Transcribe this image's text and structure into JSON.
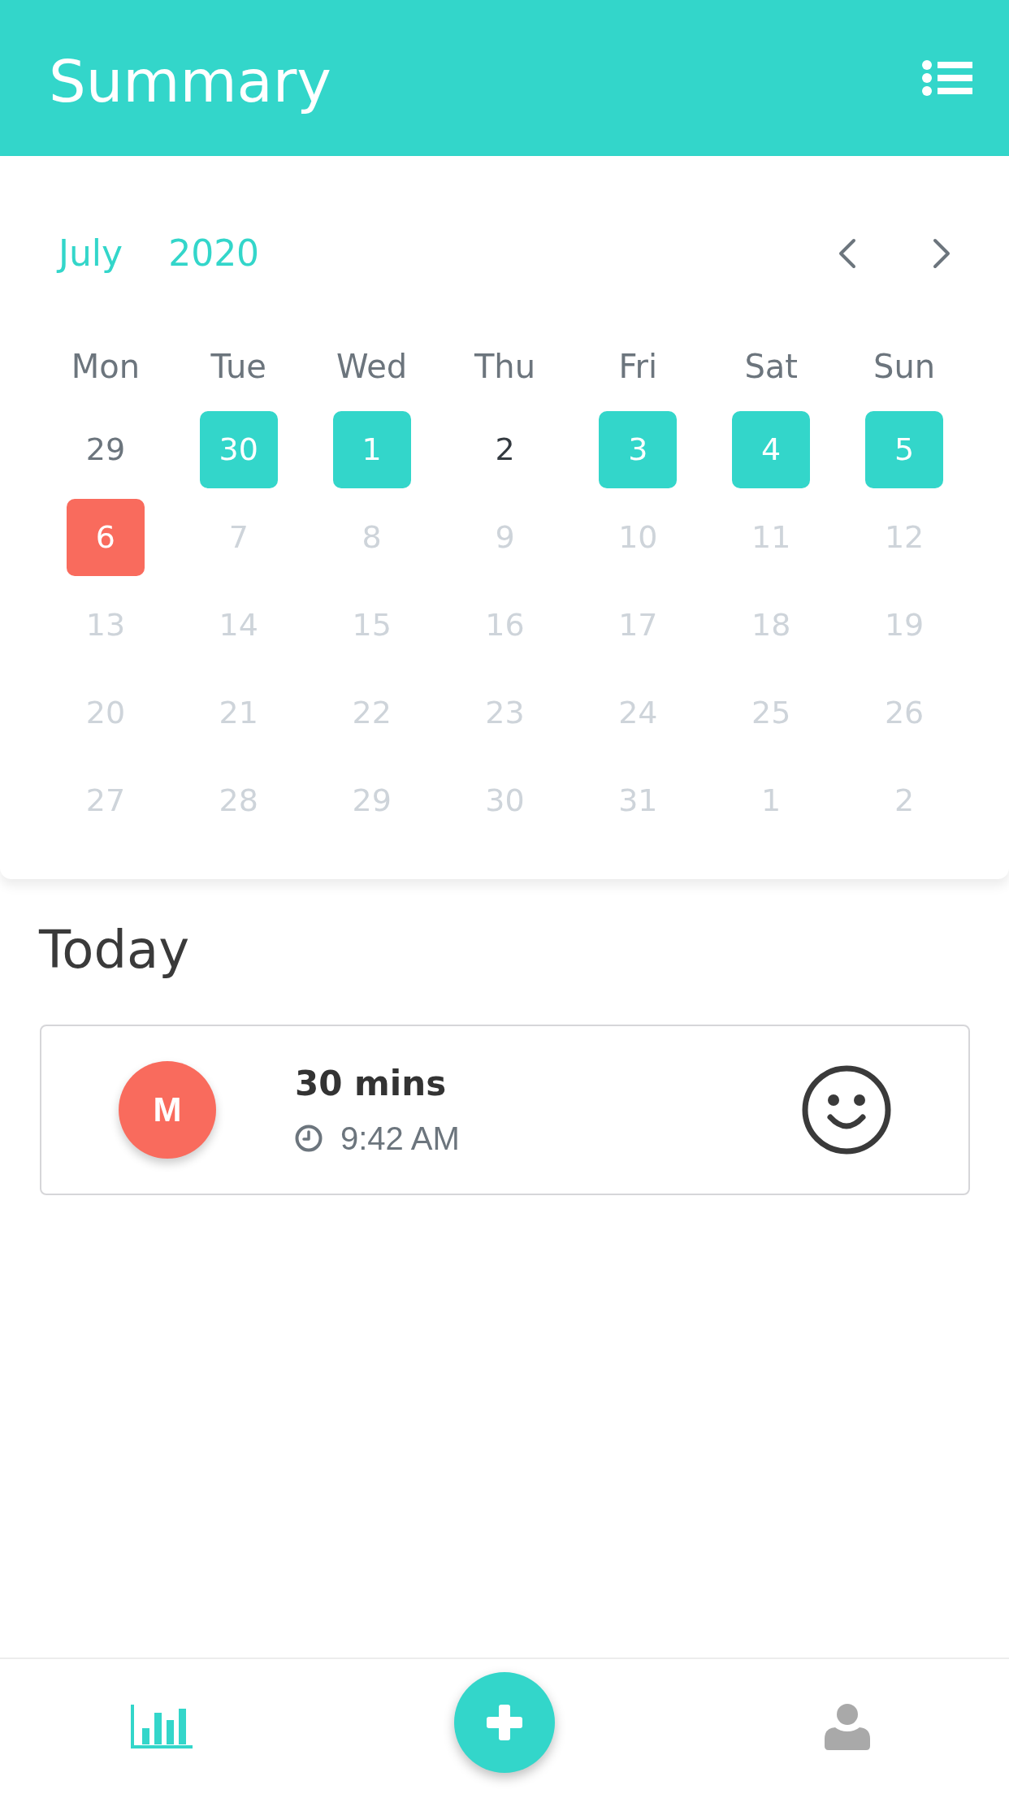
{
  "header": {
    "title": "Summary"
  },
  "calendar": {
    "month": "July",
    "year": "2020",
    "weekdays": [
      "Mon",
      "Tue",
      "Wed",
      "Thu",
      "Fri",
      "Sat",
      "Sun"
    ],
    "weeks": [
      {
        "days": [
          {
            "label": "29",
            "kind": "outside"
          },
          {
            "label": "30",
            "kind": "logged"
          },
          {
            "label": "1",
            "kind": "logged"
          },
          {
            "label": "2",
            "kind": "plain"
          },
          {
            "label": "3",
            "kind": "logged"
          },
          {
            "label": "4",
            "kind": "logged"
          },
          {
            "label": "5",
            "kind": "logged"
          }
        ]
      },
      {
        "days": [
          {
            "label": "6",
            "kind": "today"
          },
          {
            "label": "7",
            "kind": "future"
          },
          {
            "label": "8",
            "kind": "future"
          },
          {
            "label": "9",
            "kind": "future"
          },
          {
            "label": "10",
            "kind": "future"
          },
          {
            "label": "11",
            "kind": "future"
          },
          {
            "label": "12",
            "kind": "future"
          }
        ]
      },
      {
        "days": [
          {
            "label": "13",
            "kind": "future"
          },
          {
            "label": "14",
            "kind": "future"
          },
          {
            "label": "15",
            "kind": "future"
          },
          {
            "label": "16",
            "kind": "future"
          },
          {
            "label": "17",
            "kind": "future"
          },
          {
            "label": "18",
            "kind": "future"
          },
          {
            "label": "19",
            "kind": "future"
          }
        ]
      },
      {
        "days": [
          {
            "label": "20",
            "kind": "future"
          },
          {
            "label": "21",
            "kind": "future"
          },
          {
            "label": "22",
            "kind": "future"
          },
          {
            "label": "23",
            "kind": "future"
          },
          {
            "label": "24",
            "kind": "future"
          },
          {
            "label": "25",
            "kind": "future"
          },
          {
            "label": "26",
            "kind": "future"
          }
        ]
      },
      {
        "days": [
          {
            "label": "27",
            "kind": "future"
          },
          {
            "label": "28",
            "kind": "future"
          },
          {
            "label": "29",
            "kind": "future"
          },
          {
            "label": "30",
            "kind": "future"
          },
          {
            "label": "31",
            "kind": "future"
          },
          {
            "label": "1",
            "kind": "future"
          },
          {
            "label": "2",
            "kind": "future"
          }
        ]
      }
    ]
  },
  "today": {
    "title": "Today",
    "entries": [
      {
        "initial": "M",
        "duration": "30 mins",
        "time": "9:42 AM",
        "mood": {
          "kind": "happy"
        }
      }
    ]
  },
  "bottom_nav": {
    "tabs": [
      {
        "kind": "stats",
        "selected": true
      },
      {
        "kind": "profile",
        "selected": false
      }
    ]
  }
}
